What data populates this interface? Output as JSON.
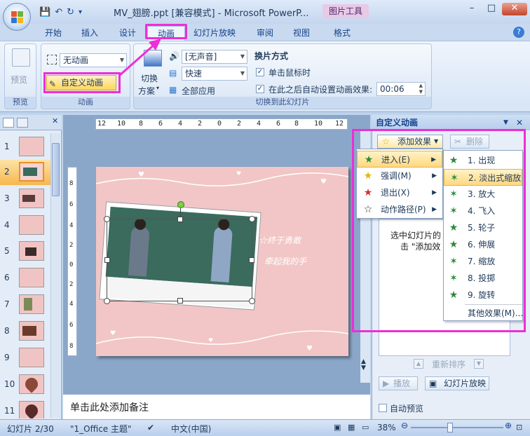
{
  "window": {
    "title": "MV_翅膀.ppt [兼容模式] - Microsoft PowerP...",
    "context_tab_title": "图片工具",
    "controls": {
      "minimize": "–",
      "maximize": "□",
      "close": "✕"
    }
  },
  "tabs": [
    "开始",
    "插入",
    "设计",
    "动画",
    "幻灯片放映",
    "审阅",
    "视图",
    "格式"
  ],
  "active_tab": "动画",
  "ribbon": {
    "preview": {
      "button": "预览",
      "group": "预览"
    },
    "animation": {
      "dropdown_value": "无动画",
      "custom_button": "自定义动画",
      "group": "动画"
    },
    "transition": {
      "scheme_label_line1": "切换",
      "scheme_label_line2": "方案",
      "sound_value": "[无声音]",
      "speed_value": "快速",
      "apply_all": "全部应用",
      "advance_heading": "换片方式",
      "on_click_label": "单击鼠标时",
      "on_click_checked": true,
      "after_label": "在此之后自动设置动画效果:",
      "after_checked": true,
      "after_time": "00:06",
      "group": "切换到此幻灯片"
    }
  },
  "slides_panel": {
    "numbers": [
      "1",
      "2",
      "3",
      "4",
      "5",
      "6",
      "7",
      "8",
      "9",
      "10",
      "11"
    ],
    "selected": "2"
  },
  "rulers": {
    "horizontal": [
      "12",
      "10",
      "8",
      "6",
      "4",
      "2",
      "0",
      "2",
      "4",
      "6",
      "8",
      "10",
      "12"
    ],
    "vertical": [
      "8",
      "6",
      "4",
      "2",
      "0",
      "2",
      "4",
      "6",
      "8"
    ]
  },
  "slide": {
    "script_text_1": "☆终于勇敢",
    "script_text_2": "牵起我的手"
  },
  "notes_placeholder": "单击此处添加备注",
  "task_pane": {
    "title": "自定义动画",
    "add_effect": "添加效果",
    "remove": "删除",
    "list_text_line1": "选中幻灯片的",
    "list_text_line2": "击 \"添加效",
    "reorder": "重新排序",
    "play": "播放",
    "slideshow": "幻灯片放映",
    "autopreview": "自动预览",
    "menu1": [
      {
        "label": "进入(E)",
        "icon": "green-star-icon"
      },
      {
        "label": "强调(M)",
        "icon": "yellow-star-icon"
      },
      {
        "label": "退出(X)",
        "icon": "red-star-icon"
      },
      {
        "label": "动作路径(P)",
        "icon": "outline-star-icon"
      }
    ],
    "menu2": [
      "1. 出现",
      "2. 淡出式缩放",
      "3. 放大",
      "4. 飞入",
      "5. 轮子",
      "6. 伸展",
      "7. 缩放",
      "8. 投掷",
      "9. 旋转"
    ],
    "menu2_hot": 1,
    "more_effects": "其他效果(M)..."
  },
  "statusbar": {
    "slide_info": "幻灯片 2/30",
    "theme": "\"1_Office 主题\"",
    "language": "中文(中国)",
    "zoom": "38%"
  },
  "colors": {
    "highlight": "#ee2ed6",
    "ribbon_bg": "#dfeaf7",
    "slide_bg": "#f2c6c6"
  }
}
